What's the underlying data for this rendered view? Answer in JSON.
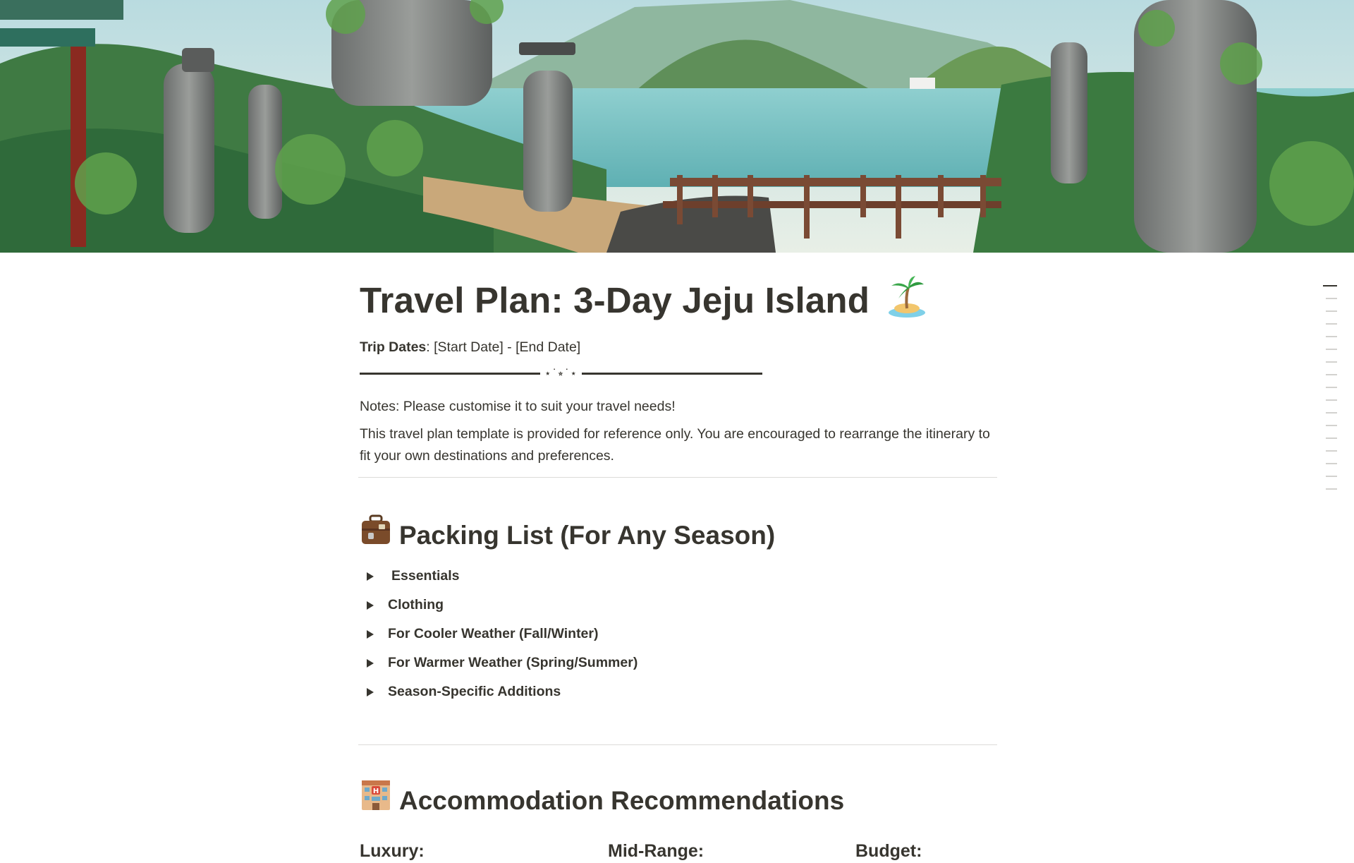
{
  "page": {
    "title": "Travel Plan: 3-Day Jeju Island",
    "title_emoji": "island-icon",
    "trip_dates_label": "Trip Dates",
    "trip_dates_value": ": [Start Date] - [End Date]",
    "divider_ornament": "⋆˙⭒˙⋆",
    "notes": "Notes: Please customise it to suit your travel needs!",
    "paragraph": "This travel plan template is provided for reference only. You are encouraged to rearrange the itinerary to fit your own destinations and preferences."
  },
  "packing": {
    "heading": "Packing List (For Any Season)",
    "icon": "luggage-icon",
    "items": [
      {
        "label": "Essentials"
      },
      {
        "label": "Clothing"
      },
      {
        "label": "For Cooler Weather (Fall/Winter)"
      },
      {
        "label": "For Warmer Weather (Spring/Summer)"
      },
      {
        "label": "Season-Specific Additions"
      }
    ]
  },
  "accommodation": {
    "heading": "Accommodation Recommendations",
    "icon": "hotel-icon",
    "columns": [
      "Luxury:",
      "Mid-Range:",
      "Budget:"
    ]
  },
  "colors": {
    "text": "#37352f",
    "divider": "#dcdbd8",
    "toc_active": "#37352f",
    "toc_inactive": "#d3d2cf"
  }
}
